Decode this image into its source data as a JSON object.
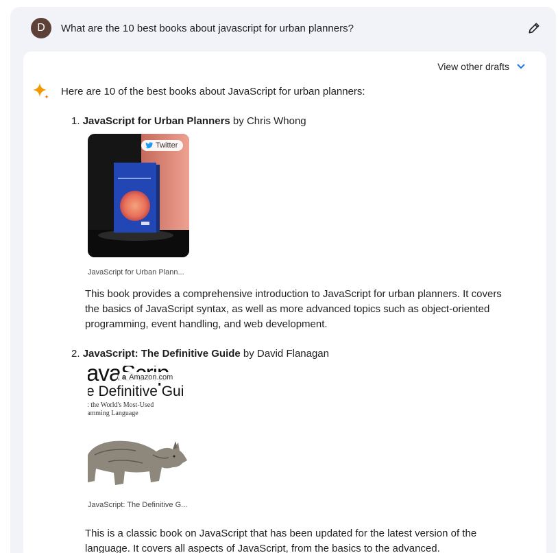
{
  "prompt": {
    "avatar_letter": "D",
    "text": "What are the 10 best books about javascript for urban planners?"
  },
  "response": {
    "view_drafts_label": "View other drafts",
    "intro": "Here are 10 of the best books about JavaScript for urban planners:",
    "items": [
      {
        "number": "1.",
        "title": "JavaScript for Urban Planners",
        "by": " by Chris Whong",
        "source_badge": "Twitter",
        "caption": "JavaScript for Urban Plann...",
        "description": "This book provides a comprehensive introduction to JavaScript for urban planners. It covers the basics of JavaScript syntax, as well as more advanced topics such as object-oriented programming, event handling, and web development."
      },
      {
        "number": "2.",
        "title": "JavaScript: The Definitive Guide",
        "by": " by David Flanagan",
        "source_badge": "Amazon.com",
        "cover_big": "avaScrip",
        "cover_sub": "e Definitive Gui",
        "cover_small_1": ": the World's Most-Used",
        "cover_small_2": "amming Language",
        "caption": "JavaScript: The Definitive G...",
        "description": "This is a classic book on JavaScript that has been updated for the latest version of the language. It covers all aspects of JavaScript, from the basics to the advanced."
      }
    ]
  },
  "colors": {
    "frame_bg": "#f2f3f9",
    "avatar_bg": "#5d4037",
    "accent_blue": "#1a73e8"
  }
}
